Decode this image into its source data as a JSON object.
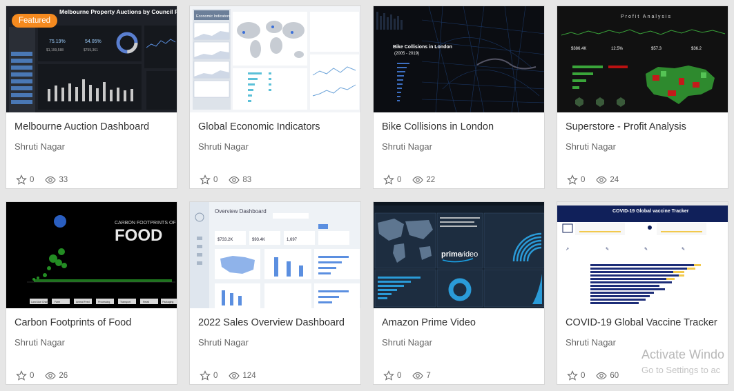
{
  "badge": "Featured",
  "cards": [
    {
      "title": "Melbourne Auction Dashboard",
      "author": "Shruti Nagar",
      "stars": "0",
      "views": "33",
      "thumb_text": {
        "header": "Melbourne Property Auctions by Council Regi",
        "k1": "75.19%",
        "k2": "54.05%",
        "k3": "$1,199,588",
        "k4": "$755,361"
      }
    },
    {
      "title": "Global Economic Indicators",
      "author": "Shruti Nagar",
      "stars": "0",
      "views": "83",
      "thumb_text": {
        "panel": "Economic Indicators"
      }
    },
    {
      "title": "Bike Collisions in London",
      "author": "Shruti Nagar",
      "stars": "0",
      "views": "22",
      "thumb_text": {
        "heading": "Bike Collisions in London",
        "years": "(2005 - 2019)"
      }
    },
    {
      "title": "Superstore - Profit Analysis",
      "author": "Shruti Nagar",
      "stars": "0",
      "views": "24",
      "thumb_text": {
        "heading": "Profit Analysis",
        "k1": "$386.4K",
        "k2": "12.5%",
        "k3": "$57.3",
        "k4": "$36.2"
      }
    },
    {
      "title": "Carbon Footprints of Food",
      "author": "Shruti Nagar",
      "stars": "0",
      "views": "26",
      "thumb_text": {
        "line1": "CARBON FOOTPRINTS OF",
        "line2": "FOOD",
        "tabs": [
          "Land Use Change",
          "Farm",
          "Animal Feed",
          "Processing",
          "Transport",
          "Retail",
          "Packaging"
        ]
      }
    },
    {
      "title": "2022 Sales Overview Dashboard",
      "author": "Shruti Nagar",
      "stars": "0",
      "views": "124",
      "thumb_text": {
        "heading": "Overview Dashboard",
        "k1": "$733.2K",
        "k2": "$93.4K",
        "k3": "1,697"
      }
    },
    {
      "title": "Amazon Prime Video",
      "author": "Shruti Nagar",
      "stars": "0",
      "views": "7",
      "thumb_text": {
        "logo1": "prime",
        "logo2": "video"
      }
    },
    {
      "title": "COVID-19 Global Vaccine Tracker",
      "author": "Shruti Nagar",
      "stars": "0",
      "views": "60",
      "thumb_text": {
        "heading": "COVID-19 Global vaccine Tracker"
      }
    }
  ],
  "watermark": {
    "line1": "Activate Windo",
    "line2": "Go to Settings to ac"
  },
  "colors": {
    "badge": "#f58a1f",
    "card_bg": "#ffffff",
    "page_bg": "#e6e6e6"
  },
  "icons": {
    "star": "star-icon",
    "views": "eye-icon"
  }
}
